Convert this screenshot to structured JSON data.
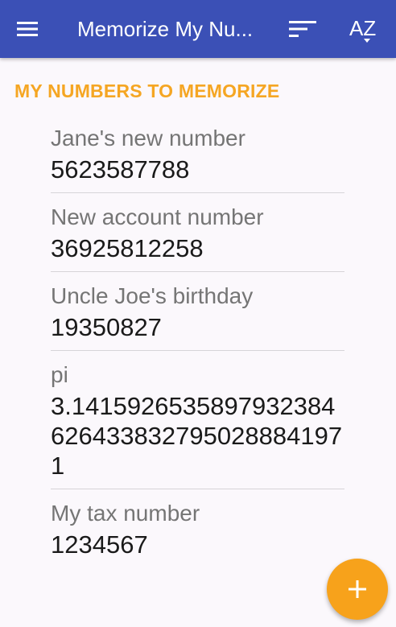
{
  "appbar": {
    "title": "Memorize My Nu...",
    "menu_icon": "hamburger-menu-icon",
    "sort_icon": "sort-lines-icon",
    "az_label": "AZ",
    "background": "#3b50b6"
  },
  "section": {
    "header": "MY NUMBERS TO MEMORIZE",
    "accent": "#f5a623"
  },
  "items": [
    {
      "label": "Jane's new number",
      "value": "5623587788"
    },
    {
      "label": "New account number",
      "value": "36925812258"
    },
    {
      "label": "Uncle Joe's birthday",
      "value": "19350827"
    },
    {
      "label": "pi",
      "value": "3.14159265358979323846264338327950288841971"
    },
    {
      "label": "My tax number",
      "value": "1234567"
    }
  ],
  "fab": {
    "icon": "plus-icon",
    "color": "#f7a21b"
  }
}
